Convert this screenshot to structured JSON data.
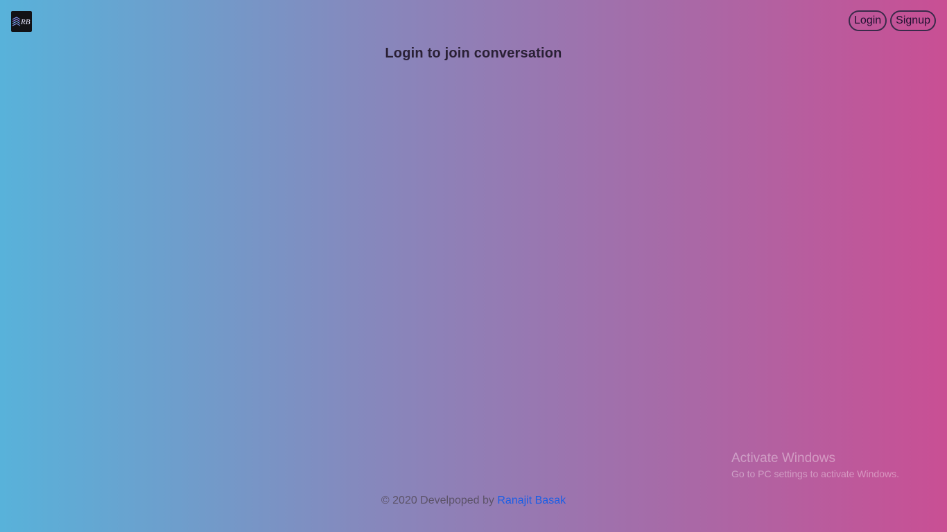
{
  "header": {
    "logo_text": "RB",
    "login_label": "Login",
    "signup_label": "Signup"
  },
  "main": {
    "heading": "Login to join conversation"
  },
  "footer": {
    "copyright": "© 2020 Develpoped by",
    "author": "Ranajit Basak"
  },
  "watermark": {
    "title": "Activate Windows",
    "subtitle": "Go to PC settings to activate Windows."
  },
  "colors": {
    "gradient_left": "#58b2da",
    "gradient_right": "#c94f94",
    "link": "#1a5ee6"
  }
}
